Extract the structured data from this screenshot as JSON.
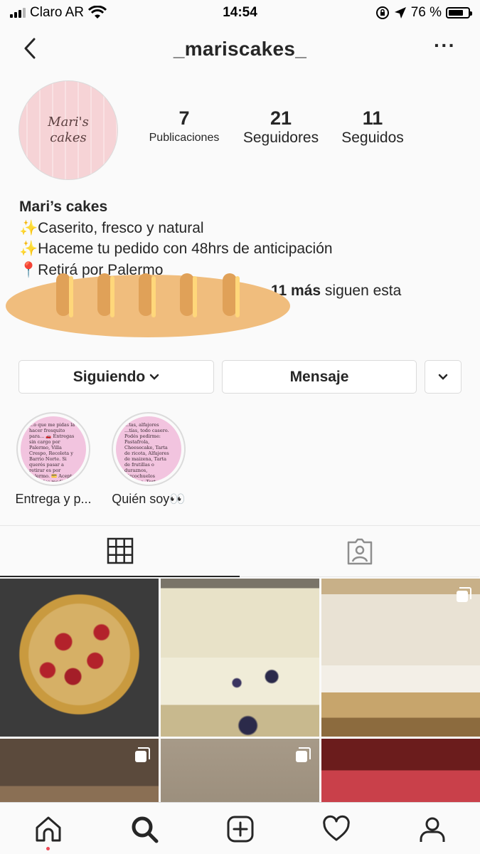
{
  "status_bar": {
    "carrier": "Claro AR",
    "time": "14:54",
    "battery_text": "76 %"
  },
  "header": {
    "username": "_mariscakes_"
  },
  "profile": {
    "avatar_text_line1": "Mari's",
    "avatar_text_line2": "cakes",
    "stats": [
      {
        "value": "7",
        "label": "Publicaciones"
      },
      {
        "value": "21",
        "label": "Seguidores"
      },
      {
        "value": "11",
        "label": "Seguidos"
      }
    ],
    "name": "Mari’s cakes",
    "bio_lines": [
      "✨Caserito, fresco y natural",
      "✨Haceme tu pedido con 48hrs de anticipación",
      "📍Retirá por Palermo"
    ],
    "followed_by_count": "11 más",
    "followed_by_suffix": " siguen esta"
  },
  "buttons": {
    "following": "Siguiendo",
    "message": "Mensaje"
  },
  "highlights": [
    {
      "label": "Entrega y p...",
      "preview": "...o que me pidas la hacer fresquito para... 🚗 Entregas sin cargo por Palermo, Villa Crespo, Recoleta y Barrio Norte. Si querés pasar a retirar es por Palermo. 💳 Acepto todos los medios de pago (efectivo, ... transf..."
    },
    {
      "label": "Quién soy👀",
      "preview": "...tas, alfajores ...tías, todo casero. Podés pedirme: Pastafrola, Cheesecake, Tarta de ricota, Alfajores de maizena, Tarta de frutillas o duraznos, Bizcochuelos rellenos, Tortas veganas, Galletitas con chips de chocolate..."
    }
  ],
  "tabs": {
    "grid_icon": "grid-icon",
    "tagged_icon": "tagged-person-icon",
    "active": "grid"
  },
  "posts": [
    {
      "subject": "berry lattice tart",
      "multiple": false
    },
    {
      "subject": "blueberry loaf cake",
      "multiple": false
    },
    {
      "subject": "lemon meringue pie",
      "multiple": true
    },
    {
      "subject": "crumble cake",
      "multiple": true
    },
    {
      "subject": "sponge cake",
      "multiple": true
    },
    {
      "subject": "strawberry tart",
      "multiple": false
    }
  ],
  "bottom_nav": [
    "home-icon",
    "search-icon",
    "add-post-icon",
    "activity-heart-icon",
    "profile-icon"
  ],
  "colors": {
    "notification_dot": "#ed4956",
    "text": "#262626",
    "border": "#dbdbdb"
  }
}
